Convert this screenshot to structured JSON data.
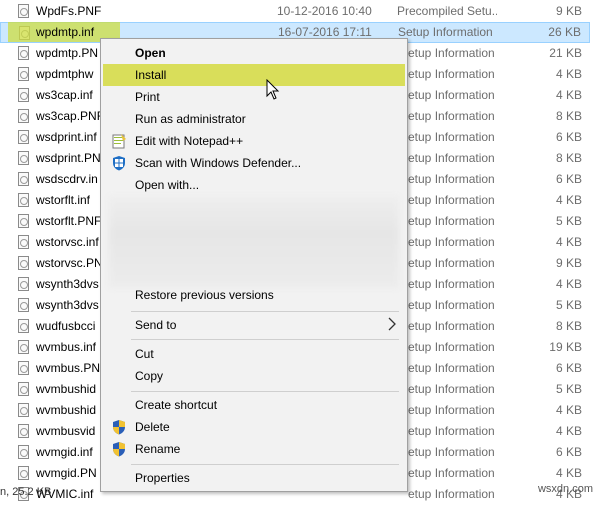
{
  "files": [
    {
      "name": "WpdFs.PNF",
      "date": "10-12-2016 10:40",
      "type": "Precompiled Setu...",
      "size": "9 KB"
    },
    {
      "name": "wpdmtp.inf",
      "date": "16-07-2016 17:11",
      "type": "Setup Information",
      "size": "26 KB",
      "selected": true
    },
    {
      "name": "wpdmtp.PN",
      "date": "",
      "type": "etup Information",
      "size": "21 KB"
    },
    {
      "name": "wpdmtphw",
      "date": "",
      "type": "etup Information",
      "size": "4 KB"
    },
    {
      "name": "ws3cap.inf",
      "date": "",
      "type": "etup Information",
      "size": "4 KB"
    },
    {
      "name": "ws3cap.PNF",
      "date": "",
      "type": "etup Information",
      "size": "8 KB"
    },
    {
      "name": "wsdprint.inf",
      "date": "",
      "type": "etup Information",
      "size": "6 KB"
    },
    {
      "name": "wsdprint.PN",
      "date": "",
      "type": "etup Information",
      "size": "8 KB"
    },
    {
      "name": "wsdscdrv.in",
      "date": "",
      "type": "etup Information",
      "size": "6 KB"
    },
    {
      "name": "wstorflt.inf",
      "date": "",
      "type": "etup Information",
      "size": "4 KB"
    },
    {
      "name": "wstorflt.PNF",
      "date": "",
      "type": "etup Information",
      "size": "5 KB"
    },
    {
      "name": "wstorvsc.inf",
      "date": "",
      "type": "etup Information",
      "size": "4 KB"
    },
    {
      "name": "wstorvsc.PN",
      "date": "",
      "type": "etup Information",
      "size": "9 KB"
    },
    {
      "name": "wsynth3dvs",
      "date": "",
      "type": "etup Information",
      "size": "4 KB"
    },
    {
      "name": "wsynth3dvs",
      "date": "",
      "type": "etup Information",
      "size": "5 KB"
    },
    {
      "name": "wudfusbcci",
      "date": "",
      "type": "etup Information",
      "size": "8 KB"
    },
    {
      "name": "wvmbus.inf",
      "date": "",
      "type": "etup Information",
      "size": "19 KB"
    },
    {
      "name": "wvmbus.PN",
      "date": "",
      "type": "etup Information",
      "size": "6 KB"
    },
    {
      "name": "wvmbushid",
      "date": "",
      "type": "etup Information",
      "size": "5 KB"
    },
    {
      "name": "wvmbushid",
      "date": "",
      "type": "etup Information",
      "size": "4 KB"
    },
    {
      "name": "wvmbusvid",
      "date": "",
      "type": "etup Information",
      "size": "4 KB"
    },
    {
      "name": "wvmgid.inf",
      "date": "",
      "type": "etup Information",
      "size": "6 KB"
    },
    {
      "name": "wvmgid.PN",
      "date": "",
      "type": "etup Information",
      "size": "4 KB"
    },
    {
      "name": "WVMIC.inf",
      "date": "",
      "type": "etup Information",
      "size": "4 KB"
    }
  ],
  "status_bar": "n, 25.2 KB",
  "watermark": "wsxdn.com",
  "context_menu": {
    "open": "Open",
    "install": "Install",
    "print": "Print",
    "run_as_admin": "Run as administrator",
    "edit_notepad": "Edit with Notepad++",
    "scan_defender": "Scan with Windows Defender...",
    "open_with": "Open with...",
    "restore_versions": "Restore previous versions",
    "send_to": "Send to",
    "cut": "Cut",
    "copy": "Copy",
    "create_shortcut": "Create shortcut",
    "delete": "Delete",
    "rename": "Rename",
    "properties": "Properties"
  },
  "icons": {
    "file": "inf-file-icon",
    "notepad": "notepad-plus-icon",
    "defender": "windows-defender-icon",
    "shield": "uac-shield-icon",
    "submenu": "chevron-right-icon"
  },
  "colors": {
    "selection": "#cce8ff",
    "highlight": "#d9de5a",
    "menu_bg": "#f2f2f2"
  }
}
